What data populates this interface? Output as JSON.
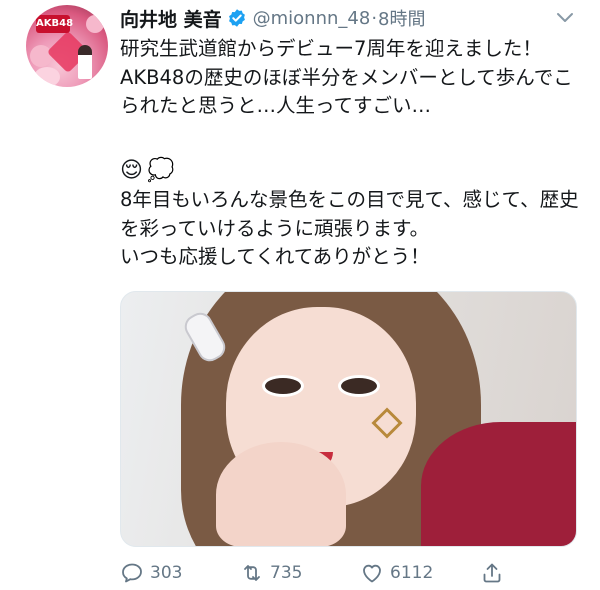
{
  "user": {
    "display_name": "向井地 美音",
    "handle": "@mionnn_48",
    "separator": "·",
    "time": "8時間",
    "avatar_logo": "AKB48",
    "verified_icon": "verified-badge-icon"
  },
  "tweet": {
    "text": "研究生武道館からデビュー7周年を迎えました！\nAKB48の歴史のほぼ半分をメンバーとして歩んでこられたと思うと…人生ってすごい…",
    "emojis": [
      "😌",
      "💭"
    ],
    "text_after": "8年目もいろんな景色をこの目で見て、感じて、歴史を彩っていけるように頑張ります。\nいつも応援してくれてありがとう！"
  },
  "actions": {
    "reply": {
      "icon": "reply-icon",
      "count": "303"
    },
    "retweet": {
      "icon": "retweet-icon",
      "count": "735"
    },
    "like": {
      "icon": "heart-icon",
      "count": "6112"
    },
    "share": {
      "icon": "share-icon"
    }
  },
  "colors": {
    "text_primary": "#14171a",
    "text_secondary": "#657786",
    "verified_blue": "#1da1f2"
  }
}
